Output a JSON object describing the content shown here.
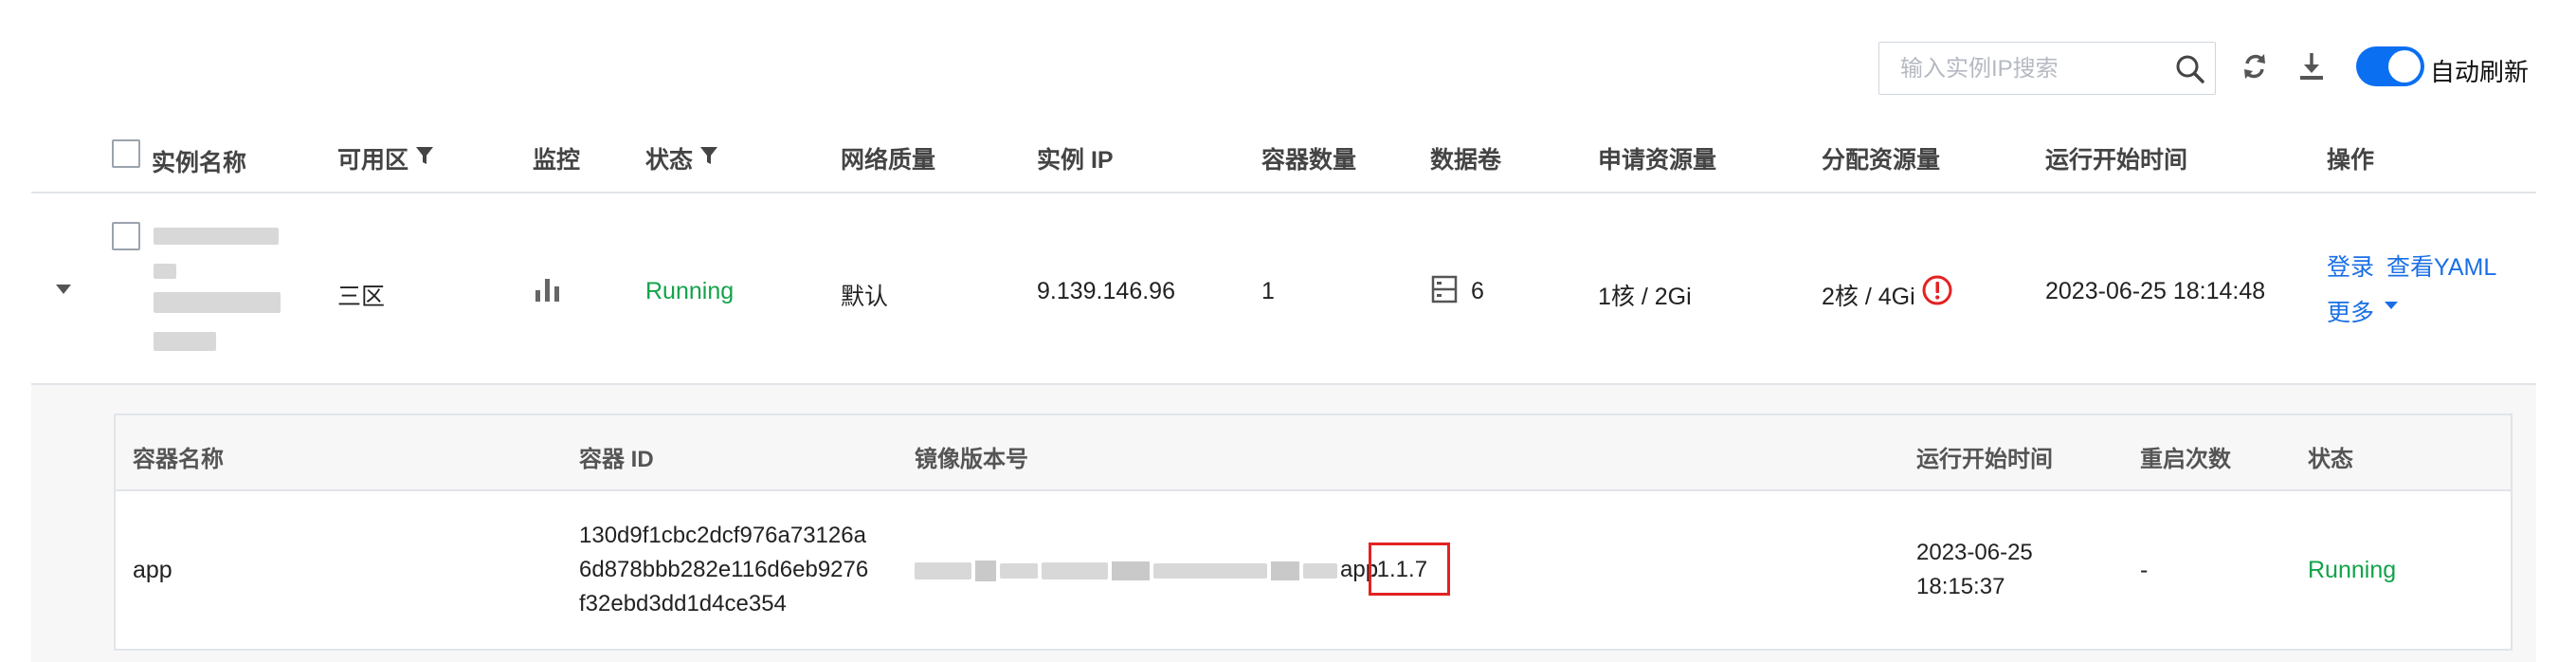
{
  "toolbar": {
    "search_placeholder": "输入实例IP搜索",
    "search_icon": "search-icon",
    "refresh_icon": "refresh-icon",
    "download_icon": "download-icon",
    "auto_refresh_label": "自动刷新",
    "auto_refresh_on": true,
    "accent_color": "#0b6ff2"
  },
  "table": {
    "headers": {
      "name": "实例名称",
      "zone": "可用区",
      "monitor": "监控",
      "status": "状态",
      "network": "网络质量",
      "ip": "实例 IP",
      "containers": "容器数量",
      "volumes": "数据卷",
      "requested": "申请资源量",
      "allocated": "分配资源量",
      "start_time": "运行开始时间",
      "actions": "操作"
    },
    "row": {
      "zone": "三区",
      "status": "Running",
      "network": "默认",
      "ip": "9.139.146.96",
      "containers": "1",
      "volumes": "6",
      "requested": "1核 / 2Gi",
      "allocated": "2核 / 4Gi",
      "start_time": "2023-06-25 18:14:48",
      "actions": {
        "login": "登录",
        "view_yaml": "查看YAML",
        "more": "更多"
      }
    }
  },
  "containers": {
    "headers": {
      "name": "容器名称",
      "id": "容器 ID",
      "image": "镜像版本号",
      "start_time": "运行开始时间",
      "restarts": "重启次数",
      "status": "状态"
    },
    "row": {
      "name": "app",
      "id_line1": "130d9f1cbc2dcf976a73126a",
      "id_line2": "6d878bbb282e116d6eb9276",
      "id_line3": "f32ebd3dd1d4ce354",
      "image_suffix": "app",
      "image_tag": ":1.1.7",
      "start_date": "2023-06-25",
      "start_clock": "18:15:37",
      "restarts": "-",
      "status": "Running"
    }
  },
  "colors": {
    "running": "#12a34a",
    "link": "#1a6fe6",
    "highlight": "#e32222",
    "alert": "#e32222"
  }
}
